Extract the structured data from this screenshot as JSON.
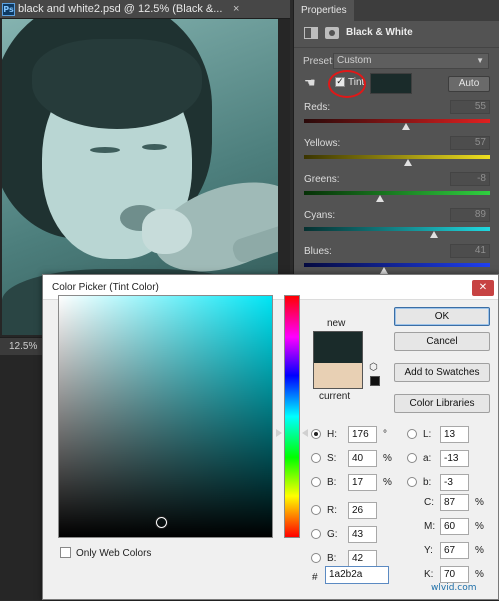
{
  "document": {
    "ps_badge": "Ps",
    "tab_title": "black and white2.psd @ 12.5% (Black &...",
    "close_glyph": "×",
    "zoom": "12.5%"
  },
  "properties": {
    "tab": "Properties",
    "title": "Black & White",
    "preset_label": "Preset:",
    "preset_value": "Custom",
    "tint_label": "Tint",
    "tint_color": "#1a2b2a",
    "auto_label": "Auto",
    "sliders": [
      {
        "label": "Reds:",
        "value": "55",
        "level": 0.55
      },
      {
        "label": "Yellows:",
        "value": "57",
        "level": 0.56
      },
      {
        "label": "Greens:",
        "value": "-8",
        "level": 0.41
      },
      {
        "label": "Cyans:",
        "value": "89",
        "level": 0.7
      },
      {
        "label": "Blues:",
        "value": "41",
        "level": 0.43
      }
    ]
  },
  "color_picker": {
    "title": "Color Picker (Tint Color)",
    "close_glyph": "✕",
    "new_label": "new",
    "current_label": "current",
    "new_color": "#1a2b2a",
    "current_color": "#e8d0b4",
    "buttons": {
      "ok": "OK",
      "cancel": "Cancel",
      "add_to_swatches": "Add to Swatches",
      "color_libraries": "Color Libraries"
    },
    "hsb": [
      {
        "label": "H:",
        "value": "176",
        "unit": "°",
        "selected": true
      },
      {
        "label": "S:",
        "value": "40",
        "unit": "%",
        "selected": false
      },
      {
        "label": "B:",
        "value": "17",
        "unit": "%",
        "selected": false
      }
    ],
    "rgb": [
      {
        "label": "R:",
        "value": "26"
      },
      {
        "label": "G:",
        "value": "43"
      },
      {
        "label": "B:",
        "value": "42"
      }
    ],
    "lab": [
      {
        "label": "L:",
        "value": "13"
      },
      {
        "label": "a:",
        "value": "-13"
      },
      {
        "label": "b:",
        "value": "-3"
      }
    ],
    "cmyk": [
      {
        "label": "C:",
        "value": "87",
        "unit": "%"
      },
      {
        "label": "M:",
        "value": "60",
        "unit": "%"
      },
      {
        "label": "Y:",
        "value": "67",
        "unit": "%"
      },
      {
        "label": "K:",
        "value": "70",
        "unit": "%"
      }
    ],
    "hex_label": "#",
    "hex_value": "1a2b2a",
    "only_web_colors": "Only Web Colors"
  },
  "watermark": "wlvid.com"
}
